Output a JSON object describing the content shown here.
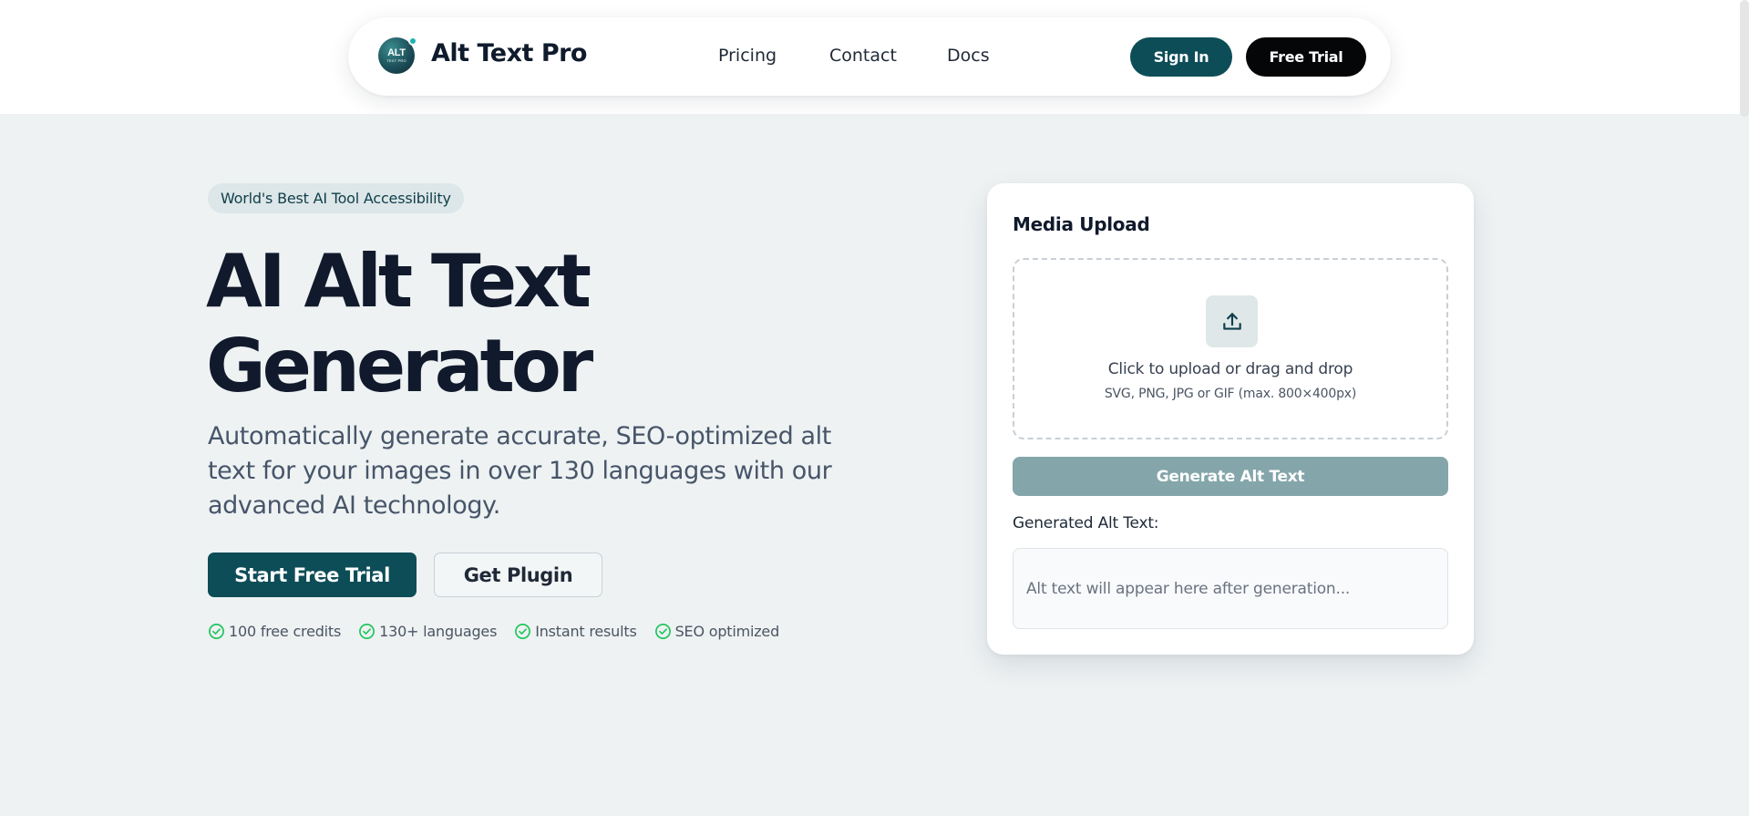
{
  "nav": {
    "logo_text": "ALT",
    "logo_subtext": "TEXT PRO",
    "brand": "Alt Text Pro",
    "links": [
      "Pricing",
      "Contact",
      "Docs"
    ],
    "sign_in": "Sign In",
    "free_trial": "Free Trial"
  },
  "hero": {
    "badge": "World's Best AI Tool Accessibility",
    "title_line1": "AI Alt Text",
    "title_line2": "Generator",
    "subtitle": "Automatically generate accurate, SEO-optimized alt text for your images in over 130 languages with our advanced AI technology.",
    "primary_cta": "Start Free Trial",
    "secondary_cta": "Get Plugin",
    "features": [
      "100 free credits",
      "130+ languages",
      "Instant results",
      "SEO optimized"
    ]
  },
  "upload_card": {
    "title": "Media Upload",
    "dropzone_main": "Click to upload or drag and drop",
    "dropzone_sub": "SVG, PNG, JPG or GIF (max. 800×400px)",
    "generate_button": "Generate Alt Text",
    "output_label": "Generated Alt Text:",
    "output_placeholder": "Alt text will appear here after generation..."
  },
  "colors": {
    "primary": "#0d4d57",
    "dark_button": "#050607",
    "page_bg": "#eef2f3",
    "check": "#22c55e",
    "generate_disabled": "#84a6aa"
  }
}
